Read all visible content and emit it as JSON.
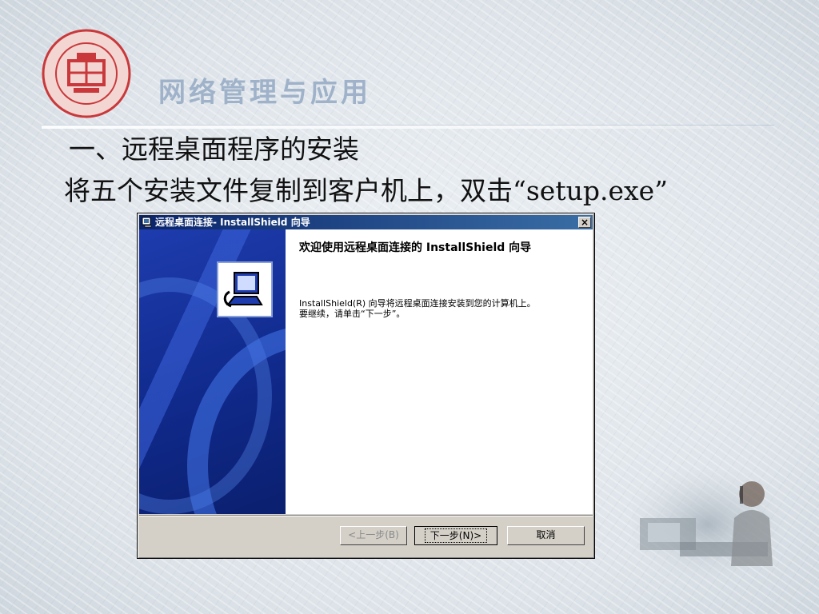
{
  "slide": {
    "header_title": "网络管理与应用",
    "heading": "一、远程桌面程序的安装",
    "instruction": "将五个安装文件复制到客户机上，双击“setup.exe”"
  },
  "installer": {
    "title": "远程桌面连接- InstallShield 向导",
    "close_label": "×",
    "welcome": "欢迎使用远程桌面连接的 InstallShield 向导",
    "desc_line1": "InstallShield(R) 向导将远程桌面连接安装到您的计算机上。",
    "desc_line2": "要继续，请单击“下一步”。",
    "buttons": {
      "back": "<上一步(B)",
      "next": "下一步(N)>",
      "cancel": "取消"
    }
  },
  "colors": {
    "title_bar": "#0a246a",
    "side_panel": "#102a8c",
    "header_text": "#9fb2c9",
    "logo_red": "#c9383a"
  },
  "icons": [
    "university-logo",
    "installer-app-icon",
    "installer-computer-icon",
    "close-icon"
  ]
}
